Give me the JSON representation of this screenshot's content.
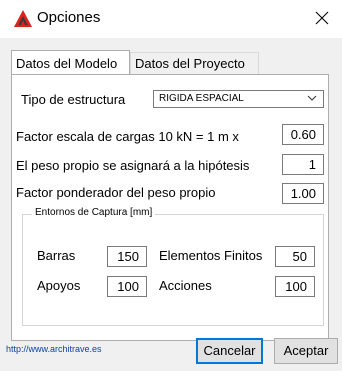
{
  "window": {
    "title": "Opciones"
  },
  "tabs": [
    {
      "label": "Datos del Modelo"
    },
    {
      "label": "Datos del Proyecto"
    }
  ],
  "model": {
    "structure_type_label": "Tipo de estructura",
    "structure_type_value": "RIGIDA ESPACIAL",
    "load_scale_label": "Factor escala de cargas   10 kN = 1 m  x",
    "load_scale_value": "0.60",
    "self_weight_label": "El peso propio se asignará a la hipótesis",
    "self_weight_value": "1",
    "self_weight_factor_label": "Factor ponderador del peso propio",
    "self_weight_factor_value": "1.00",
    "capture": {
      "title": "Entornos de Captura  [mm]",
      "bars_label": "Barras",
      "bars_value": "150",
      "fe_label": "Elementos Finitos",
      "fe_value": "50",
      "supports_label": "Apoyos",
      "supports_value": "100",
      "actions_label": "Acciones",
      "actions_value": "100"
    }
  },
  "footer": {
    "link": "http://www.architrave.es",
    "cancel": "Cancelar",
    "accept": "Aceptar"
  },
  "colors": {
    "icon_red": "#d9231c",
    "icon_dark": "#3a3a3a",
    "focus_blue": "#0078d7"
  },
  "icons": [
    "app-logo-icon",
    "close-icon",
    "chevron-down-icon"
  ]
}
